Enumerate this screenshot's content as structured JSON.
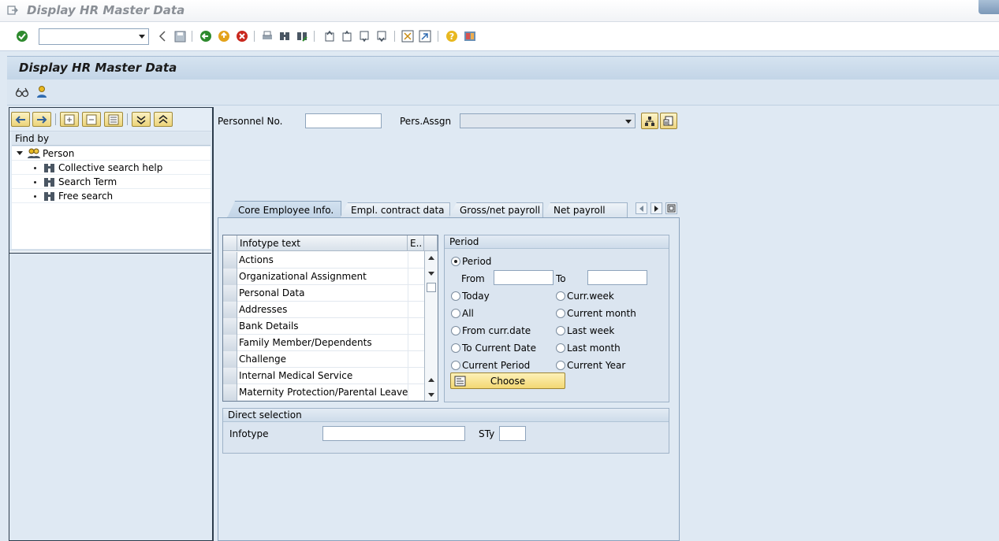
{
  "window": {
    "title": "Display HR Master Data"
  },
  "system_toolbar": {
    "command_field_value": ""
  },
  "app": {
    "title": "Display HR Master Data"
  },
  "left_panel": {
    "find_by_label": "Find by",
    "tree": {
      "root": "Person",
      "items": [
        "Collective search help",
        "Search Term",
        "Free search"
      ]
    }
  },
  "header_fields": {
    "personnel_no_label": "Personnel No.",
    "personnel_no_value": "",
    "pers_assgn_label": "Pers.Assgn",
    "pers_assgn_value": ""
  },
  "tabs": [
    "Core Employee Info.",
    "Empl. contract data",
    "Gross/net payroll",
    "Net payroll"
  ],
  "active_tab": "Core Employee Info.",
  "infotype_table": {
    "columns": [
      "Infotype text",
      "E.."
    ],
    "rows": [
      "Actions",
      "Organizational Assignment",
      "Personal Data",
      "Addresses",
      "Bank Details",
      "Family Member/Dependents",
      "Challenge",
      "Internal Medical Service",
      "Maternity Protection/Parental Leave"
    ]
  },
  "period": {
    "title": "Period",
    "period_option": "Period",
    "from_label": "From",
    "from_value": "",
    "to_label": "To",
    "to_value": "",
    "options_left": [
      "Today",
      "All",
      "From curr.date",
      "To Current Date",
      "Current Period"
    ],
    "options_right": [
      "Curr.week",
      "Current month",
      "Last week",
      "Last month",
      "Current Year"
    ],
    "selected": "Period",
    "choose_label": "Choose"
  },
  "direct_selection": {
    "title": "Direct selection",
    "infotype_label": "Infotype",
    "infotype_value": "",
    "sty_label": "STy",
    "sty_value": ""
  },
  "colors": {
    "accent": "#efd680",
    "header_bg": "#c3d5e7",
    "panel_bg": "#dfe9f3"
  }
}
